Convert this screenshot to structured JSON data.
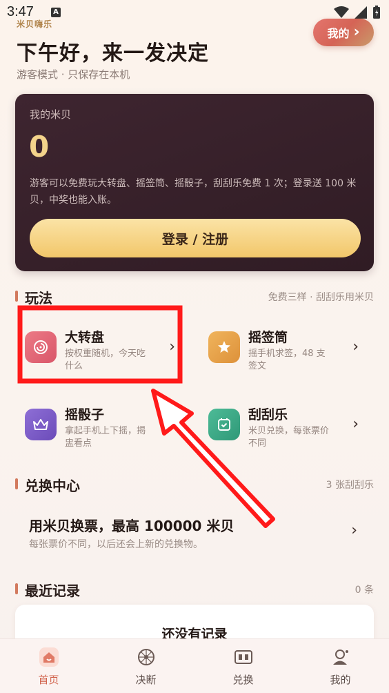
{
  "status_bar": {
    "time": "3:47",
    "notif": "A"
  },
  "header": {
    "brand": "米贝嗨乐",
    "greeting": "下午好，来一发决定",
    "subtitle": "游客模式 · 只保存在本机",
    "my_button": "我的",
    "my_button_chevron": "›"
  },
  "points_card": {
    "label": "我的米贝",
    "value": "0",
    "description": "游客可以免费玩大转盘、摇签筒、摇骰子，刮刮乐免费 1 次；登录送 100 米贝，中奖也能入账。",
    "login_button": "登录 / 注册"
  },
  "games_section": {
    "title": "玩法",
    "meta": "免费三样 · 刮刮乐用米贝",
    "items": [
      {
        "name": "大转盘",
        "desc": "按权重随机，今天吃什么",
        "icon": "wheel-icon",
        "color": "#e0616e"
      },
      {
        "name": "摇签筒",
        "desc": "摇手机求签，48 支签文",
        "icon": "star-icon",
        "color": "#e8a24a"
      },
      {
        "name": "摇骰子",
        "desc": "拿起手机上下摇，揭盅看点",
        "icon": "crown-icon",
        "color": "#7c5cc9"
      },
      {
        "name": "刮刮乐",
        "desc": "米贝兑换，每张票价不同",
        "icon": "ticket-icon",
        "color": "#3aa886"
      }
    ],
    "arrow": "›"
  },
  "exchange_section": {
    "title": "兑换中心",
    "meta": "3 张刮刮乐",
    "card_title": "用米贝换票，最高 100000 米贝",
    "card_desc": "每张票价不同，以后还会上新的兑换物。",
    "arrow": "›"
  },
  "records_section": {
    "title": "最近记录",
    "meta": "0 条",
    "empty": "还没有记录"
  },
  "tabbar": [
    {
      "label": "首页",
      "icon": "home-icon",
      "active": true
    },
    {
      "label": "决断",
      "icon": "decide-icon",
      "active": false
    },
    {
      "label": "兑换",
      "icon": "exchange-icon",
      "active": false
    },
    {
      "label": "我的",
      "icon": "profile-icon",
      "active": false
    }
  ],
  "colors": {
    "accent": "#d2654f",
    "annotation": "#ff1a1a",
    "gold": "#f3d38b"
  }
}
